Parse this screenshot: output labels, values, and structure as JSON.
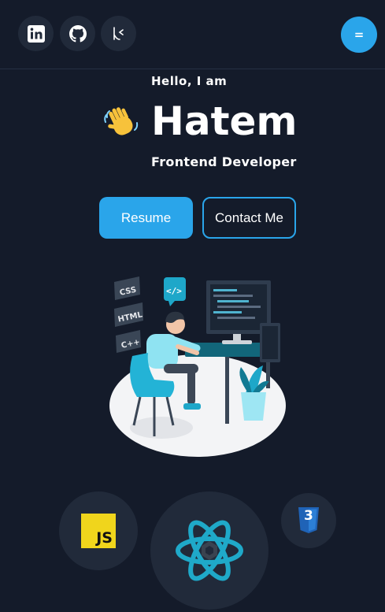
{
  "header": {
    "social": [
      {
        "name": "linkedin-icon"
      },
      {
        "name": "github-icon"
      },
      {
        "name": "kaggle-icon"
      }
    ],
    "menu_label": "="
  },
  "hero": {
    "greeting": "Hello, I am",
    "name": "Hatem",
    "role": "Frontend Developer",
    "resume_label": "Resume",
    "contact_label": "Contact Me"
  },
  "illustration": {
    "tags": [
      "CSS",
      "HTML",
      "C++"
    ],
    "code_bubble": "</>"
  },
  "tech": {
    "js_label": "JS",
    "css_label": "3"
  },
  "colors": {
    "background": "#141b2a",
    "accent": "#2aa5ea",
    "surface": "#212a3a"
  }
}
